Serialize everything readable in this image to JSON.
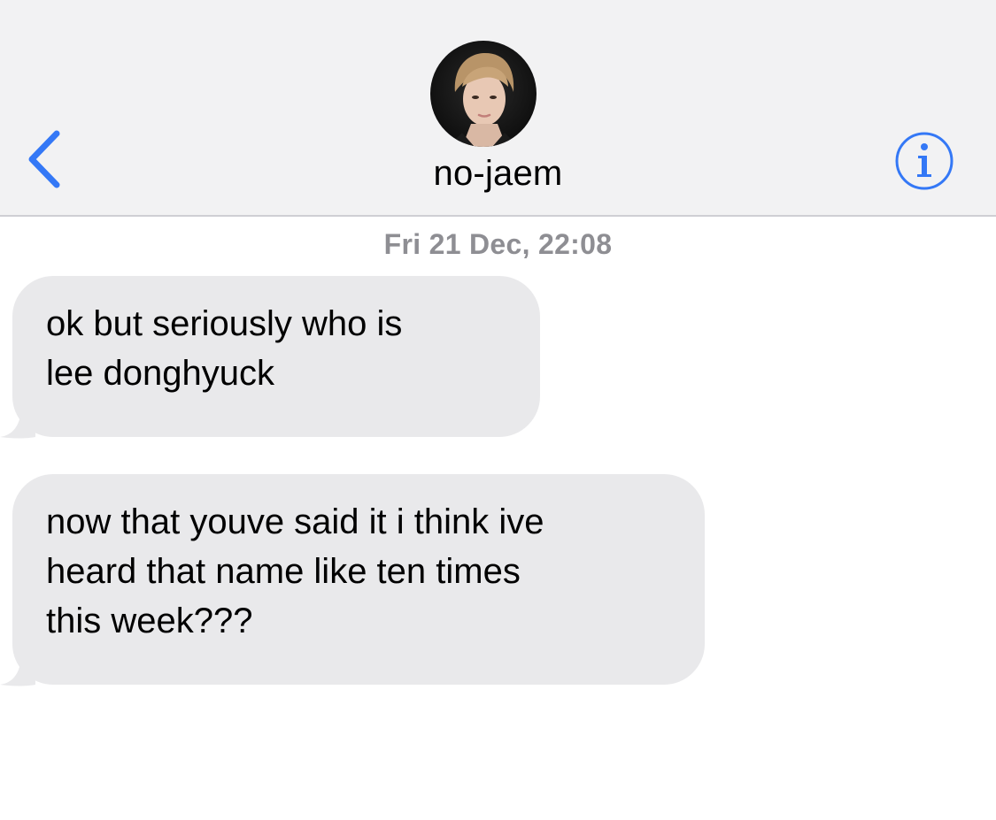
{
  "header": {
    "contact_name": "no-jaem",
    "back_icon": "chevron-left-icon",
    "info_icon": "info-circle-icon",
    "accent_color": "#3478f6",
    "background_color": "#f2f2f3"
  },
  "conversation": {
    "timestamp": "Fri 21 Dec, 22:08",
    "messages": [
      {
        "direction": "incoming",
        "lines": [
          "ok but seriously who is",
          "lee donghyuck"
        ]
      },
      {
        "direction": "incoming",
        "lines": [
          "now that youve said it i think ive",
          "heard that name like ten times",
          "this week???"
        ]
      }
    ],
    "bubble_color": "#e9e9eb",
    "timestamp_color": "#8e8e93"
  }
}
